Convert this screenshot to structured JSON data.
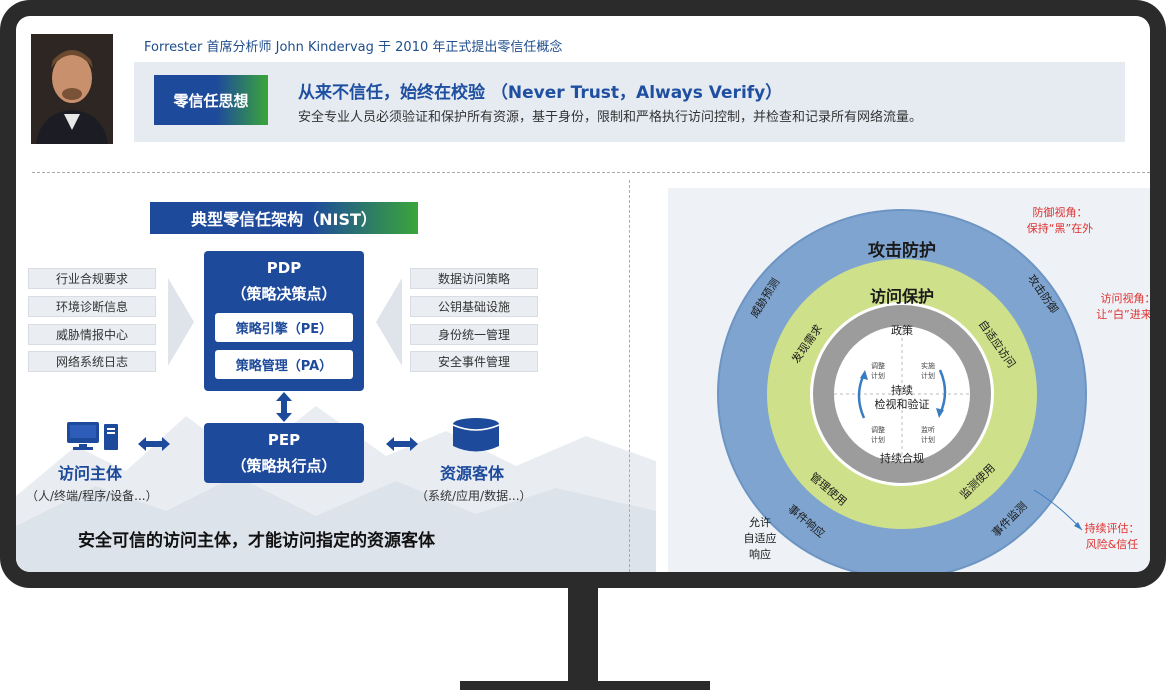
{
  "header": {
    "intro": "Forrester 首席分析师 John Kindervag 于 2010 年正式提出零信任概念"
  },
  "banner": {
    "tag": "零信任思想",
    "slogan": "从来不信任，始终在校验  （Never  Trust，Always  Verify）",
    "description": "安全专业人员必须验证和保护所有资源，基于身份，限制和严格执行访问控制，并检查和记录所有网络流量。"
  },
  "nist": {
    "title": "典型零信任架构（NIST）",
    "left_items": [
      "行业合规要求",
      "环境诊断信息",
      "威胁情报中心",
      "网络系统日志"
    ],
    "right_items": [
      "数据访问策略",
      "公钥基础设施",
      "身份统一管理",
      "安全事件管理"
    ],
    "pdp": {
      "title": "PDP",
      "subtitle": "（策略决策点）",
      "engine": "策略引擎（PE）",
      "admin": "策略管理（PA）"
    },
    "pep": {
      "title": "PEP",
      "subtitle": "（策略执行点）"
    },
    "subject": {
      "title": "访问主体",
      "detail": "（人/终端/程序/设备...）"
    },
    "resource": {
      "title": "资源客体",
      "detail": "（系统/应用/数据...）"
    },
    "conclusion": "安全可信的访问主体，才能访问指定的资源客体"
  },
  "rings": {
    "outer_title": "攻击防护",
    "middle_title": "访问保护",
    "outer_left": "威胁预测",
    "outer_right": "攻击防御",
    "outer_bottom_left": "事件响应",
    "outer_bottom_right": "事件监测",
    "middle_left": "发现需求",
    "middle_right": "自适应访问",
    "middle_bottom_left": "管理使用",
    "middle_bottom_right": "监测使用",
    "inner_top": "政策",
    "inner_bottom": "持续合规",
    "center_line1": "持续",
    "center_line2": "检视和验证",
    "quad_tl": [
      "调整",
      "计划"
    ],
    "quad_tr": [
      "实施",
      "计划"
    ],
    "quad_bl": [
      "调整",
      "计划"
    ],
    "quad_br": [
      "监听",
      "计划"
    ],
    "note_defense": [
      "防御视角：",
      "保持“黑”在外"
    ],
    "note_access": [
      "访问视角：",
      "让“白”进来"
    ],
    "note_assess": [
      "持续评估：",
      "风险&信任"
    ],
    "note_allow": [
      "允许",
      "自适应",
      "响应"
    ],
    "colors": {
      "outer": "#7fa4cf",
      "middle": "#cfe08a",
      "inner_gray": "#9c9c9c",
      "center": "#ffffff",
      "note_red": "#e03030"
    }
  }
}
